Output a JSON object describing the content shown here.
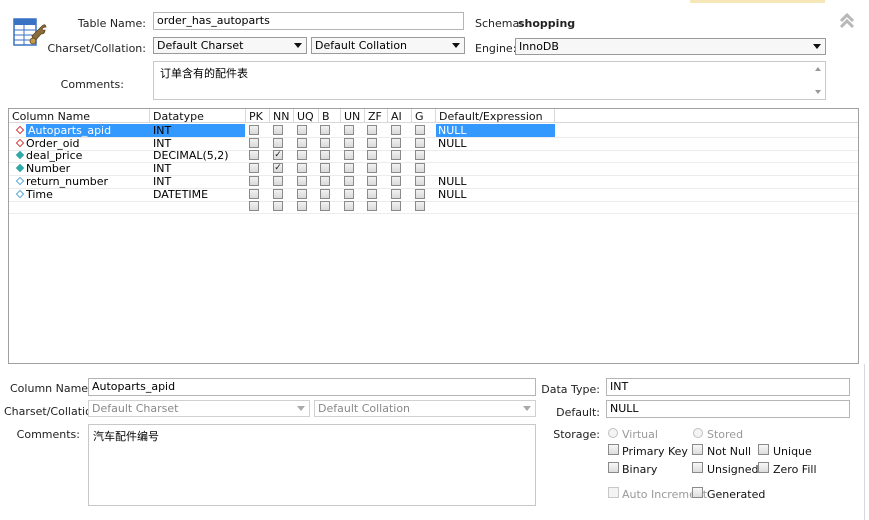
{
  "header": {
    "table_name_label": "Table Name:",
    "table_name_value": "order_has_autoparts",
    "schema_label": "Schema:",
    "schema_value": "shopping",
    "charset_label": "Charset/Collation:",
    "charset_value": "Default Charset",
    "collation_value": "Default Collation",
    "engine_label": "Engine:",
    "engine_value": "InnoDB",
    "comments_label": "Comments:",
    "comments_value": "订单含有的配件表"
  },
  "grid": {
    "columns": [
      "Column Name",
      "Datatype",
      "PK",
      "NN",
      "UQ",
      "B",
      "UN",
      "ZF",
      "AI",
      "G",
      "Default/Expression"
    ],
    "rows": [
      {
        "name": "Autoparts_apid",
        "type": "INT",
        "flags": [
          false,
          false,
          false,
          false,
          false,
          false,
          false,
          false
        ],
        "default": "NULL",
        "icon": "red",
        "selected": true
      },
      {
        "name": "Order_oid",
        "type": "INT",
        "flags": [
          false,
          false,
          false,
          false,
          false,
          false,
          false,
          false
        ],
        "default": "NULL",
        "icon": "red",
        "selected": false
      },
      {
        "name": "deal_price",
        "type": "DECIMAL(5,2)",
        "flags": [
          false,
          true,
          false,
          false,
          false,
          false,
          false,
          false
        ],
        "default": "",
        "icon": "teal",
        "selected": false
      },
      {
        "name": "Number",
        "type": "INT",
        "flags": [
          false,
          true,
          false,
          false,
          false,
          false,
          false,
          false
        ],
        "default": "",
        "icon": "teal",
        "selected": false
      },
      {
        "name": "return_number",
        "type": "INT",
        "flags": [
          false,
          false,
          false,
          false,
          false,
          false,
          false,
          false
        ],
        "default": "NULL",
        "icon": "hollow",
        "selected": false
      },
      {
        "name": "Time",
        "type": "DATETIME",
        "flags": [
          false,
          false,
          false,
          false,
          false,
          false,
          false,
          false
        ],
        "default": "NULL",
        "icon": "hollow",
        "selected": false
      }
    ]
  },
  "detail": {
    "column_name_label": "Column Name:",
    "column_name_value": "Autoparts_apid",
    "charset_label": "Charset/Collation:",
    "charset_value": "Default Charset",
    "collation_value": "Default Collation",
    "comments_label": "Comments:",
    "comments_value": "汽车配件编号",
    "data_type_label": "Data Type:",
    "data_type_value": "INT",
    "default_label": "Default:",
    "default_value": "NULL",
    "storage_label": "Storage:",
    "virtual_label": "Virtual",
    "stored_label": "Stored",
    "primary_key_label": "Primary Key",
    "not_null_label": "Not Null",
    "unique_label": "Unique",
    "binary_label": "Binary",
    "unsigned_label": "Unsigned",
    "zero_fill_label": "Zero Fill",
    "auto_increment_label": "Auto Increment",
    "generated_label": "Generated"
  },
  "colors": {
    "selection": "#3399ff",
    "fk_icon": "#d23c3c",
    "col_icon": "#2fa8a8",
    "hollow_icon": "#59a7d8",
    "table_icon": "#3a72c4"
  },
  "icons": {
    "table_editor": "table-wrench-icon",
    "collapse": "double-chevron-up-icon"
  }
}
